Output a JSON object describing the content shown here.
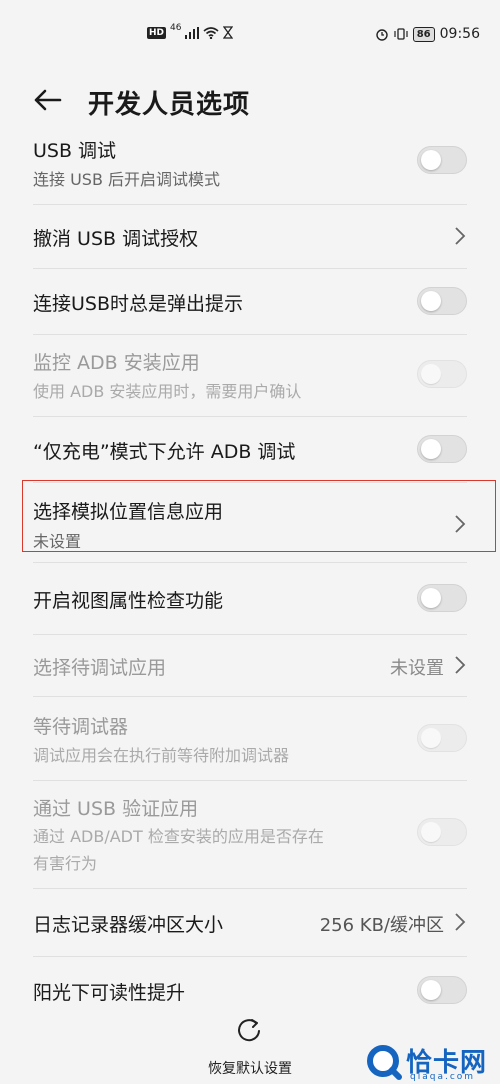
{
  "status_bar": {
    "hd": "HD",
    "network": "46",
    "time": "09:56",
    "battery": "86"
  },
  "header": {
    "title": "开发人员选项"
  },
  "rows": [
    {
      "title": "USB 调试",
      "subtitle": "连接 USB 后开启调试模式",
      "control": "toggle",
      "state": "off",
      "enabled": true
    },
    {
      "title": "撤消 USB 调试授权",
      "control": "chevron",
      "enabled": true
    },
    {
      "title": "连接USB时总是弹出提示",
      "control": "toggle",
      "state": "off",
      "enabled": true
    },
    {
      "title": "监控 ADB 安装应用",
      "subtitle": "使用 ADB 安装应用时，需要用户确认",
      "control": "toggle",
      "state": "off",
      "enabled": false
    },
    {
      "title": "“仅充电”模式下允许 ADB 调试",
      "control": "toggle",
      "state": "off",
      "enabled": true
    },
    {
      "title": "选择模拟位置信息应用",
      "subtitle": "未设置",
      "control": "chevron",
      "enabled": true,
      "highlighted": true
    },
    {
      "title": "开启视图属性检查功能",
      "control": "toggle",
      "state": "off",
      "enabled": true
    },
    {
      "title": "选择待调试应用",
      "value": "未设置",
      "control": "chevron",
      "enabled": false
    },
    {
      "title": "等待调试器",
      "subtitle": "调试应用会在执行前等待附加调试器",
      "control": "toggle",
      "state": "off",
      "enabled": false
    },
    {
      "title": "通过 USB 验证应用",
      "subtitle_lines": [
        "通过 ADB/ADT 检查安装的应用是否存在",
        "有害行为"
      ],
      "control": "toggle",
      "state": "off",
      "enabled": false
    },
    {
      "title": "日志记录器缓冲区大小",
      "value": "256 KB/缓冲区",
      "control": "chevron",
      "enabled": true
    },
    {
      "title": "阳光下可读性提升",
      "control": "toggle",
      "state": "off",
      "enabled": true
    }
  ],
  "bottom_bar": {
    "reset_label": "恢复默认设置"
  },
  "watermark": {
    "text": "恰卡网",
    "sub": "qiaqa.com"
  },
  "colors": {
    "highlight": "#d9382b",
    "background": "#f4f4f4",
    "watermark": "#1565c0"
  }
}
